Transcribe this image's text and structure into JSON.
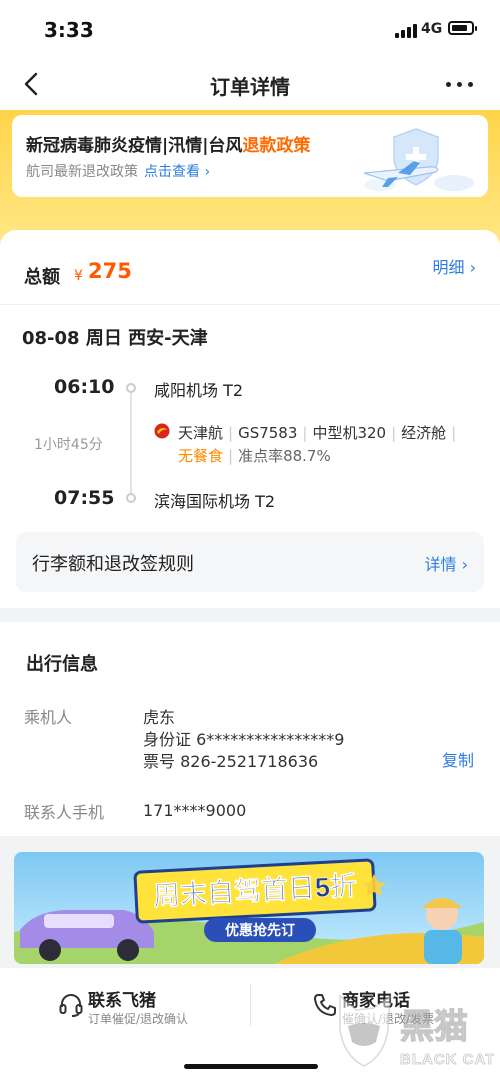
{
  "status": {
    "time": "3:33",
    "network": "4G",
    "battery_level": 0.85
  },
  "nav": {
    "title": "订单详情",
    "back_icon": "chevron-left-icon",
    "more_icon": "more-dots-icon"
  },
  "notice": {
    "title": "新冠病毒肺炎疫情|汛情|台风",
    "title_link": "退款政策",
    "subtitle": "航司最新退改政策",
    "check_link": "点击查看 ›"
  },
  "order": {
    "total_label": "总额",
    "currency": "¥",
    "total_amount": "275",
    "detail_link": "明细 ›"
  },
  "flight": {
    "date_route": "08-08 周日 西安-天津",
    "depart_time": "06:10",
    "depart_airport": "咸阳机场 T2",
    "duration": "1小时45分",
    "airline": "天津航",
    "flight_no": "GS7583",
    "aircraft": "中型机320",
    "cabin": "经济舱",
    "meal": "无餐食",
    "on_time": "准点率88.7%",
    "arrive_time": "07:55",
    "arrive_airport": "滨海国际机场 T2"
  },
  "rules": {
    "label": "行李额和退改签规则",
    "link": "详情 ›"
  },
  "travel_info": {
    "title": "出行信息",
    "passenger_label": "乘机人",
    "passenger_name": "虎东",
    "id_line": "身份证 6****************9",
    "ticket_line": "票号 826-2521718636",
    "copy_label": "复制",
    "phone_label": "联系人手机",
    "phone_value": "171****9000"
  },
  "banner": {
    "headline": "周末自驾首日5折",
    "cta": "优惠抢先订"
  },
  "bottom": {
    "contact_main": "联系飞猪",
    "contact_sub": "订单催促/退改确认",
    "merchant_main": "商家电话",
    "merchant_sub": "催确认/退改/发票"
  },
  "watermark": {
    "cn": "黑猫",
    "en": "BLACK CAT"
  },
  "colors": {
    "accent_orange": "#ff5a00",
    "link_blue": "#2d7de0",
    "brand_yellow": "#ffd44a"
  }
}
